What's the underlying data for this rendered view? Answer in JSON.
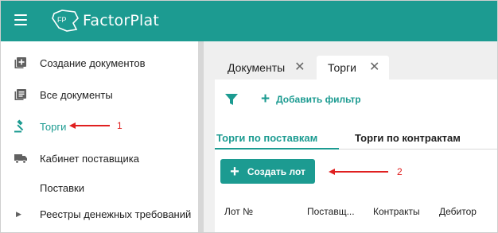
{
  "app": {
    "logo_mark": "FP",
    "logo_text": "FactorPlat"
  },
  "colors": {
    "brand": "#1c9b91",
    "annotation": "#e02020"
  },
  "sidebar": {
    "items": [
      {
        "label": "Создание документов",
        "icon": "add-document-icon"
      },
      {
        "label": "Все документы",
        "icon": "documents-list-icon"
      },
      {
        "label": "Торги",
        "icon": "gavel-icon",
        "active": true
      },
      {
        "label": "Кабинет поставщика",
        "icon": "truck-icon"
      },
      {
        "label": "Поставки"
      },
      {
        "label": "Реестры денежных требований",
        "icon": "caret-right-icon"
      }
    ]
  },
  "tabs": [
    {
      "label": "Документы",
      "close": "✕"
    },
    {
      "label": "Торги",
      "close": "✕",
      "active": true
    }
  ],
  "filter": {
    "add_filter_label": "Добавить фильтр",
    "plus": "+"
  },
  "subtabs": [
    {
      "label": "Торги по поставкам",
      "active": true
    },
    {
      "label": "Торги по контрактам"
    }
  ],
  "create_button": {
    "plus": "+",
    "label": "Создать лот"
  },
  "table": {
    "columns": [
      "Лот №",
      "Поставщ...",
      "Контракты",
      "Дебитор"
    ]
  },
  "annotations": [
    "1",
    "2"
  ]
}
